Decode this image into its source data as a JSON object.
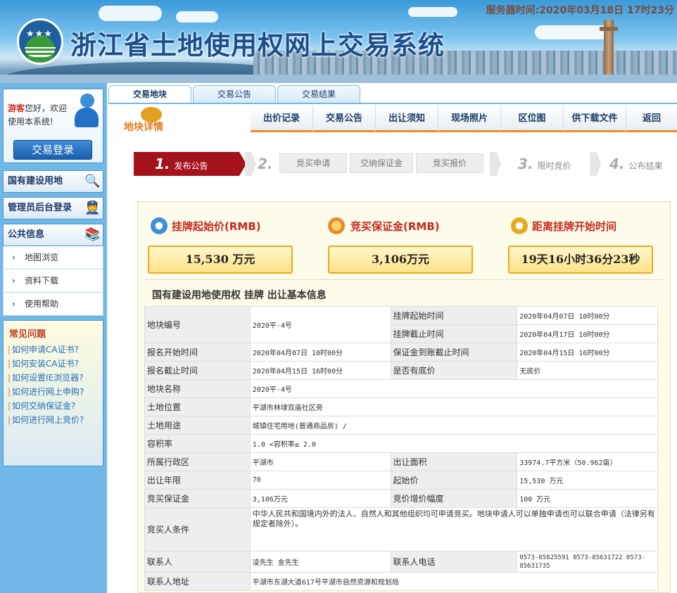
{
  "header": {
    "site_title": "浙江省土地使用权网上交易系统",
    "server_time": "服务器时间:2020年03月18日  17时23分"
  },
  "sidebar": {
    "welcome_guest": "游客",
    "welcome_text": "您好，欢迎使用本系统!",
    "login_button": "交易登录",
    "sections": {
      "gov_land": "国有建设用地",
      "admin_login": "管理员后台登录",
      "public_info": "公共信息"
    },
    "public_items": [
      "地图浏览",
      "资料下载",
      "使用帮助"
    ],
    "faq_title": "常见问题",
    "faq_items": [
      "如何申请CA证书?",
      "如何安装CA证书?",
      "如何设置IE浏览器?",
      "如何进行网上申购?",
      "如何交纳保证金?",
      "如何进行网上竞价?"
    ]
  },
  "top_tabs": [
    "交易地块",
    "交易公告",
    "交易结果"
  ],
  "detail_label": "地块详情",
  "sub_tabs": [
    "出价记录",
    "交易公告",
    "出让须知",
    "现场照片",
    "区位图",
    "供下载文件",
    "返回"
  ],
  "steps": {
    "s1_num": "1.",
    "s1_label": "发布公告",
    "s2_num": "2.",
    "s2_items": [
      "竞买申请",
      "交纳保证金",
      "竞买报价"
    ],
    "s3_num": "3.",
    "s3_label": "限时竞价",
    "s4_num": "4.",
    "s4_label": "公布结果"
  },
  "stats": {
    "start_price_title": "挂牌起始价(RMB)",
    "start_price_value": "15,530 万元",
    "deposit_title": "竞买保证金(RMB)",
    "deposit_value": "3,106万元",
    "countdown_title": "距离挂牌开始时间",
    "countdown_value": "19天16小时36分23秒"
  },
  "info_heading": "国有建设用地使用权 挂牌 出让基本信息",
  "info": {
    "plot_no_k": "地块编号",
    "plot_no_v": "2020平-4号",
    "list_start_k": "挂牌起始时间",
    "list_start_v": "2020年04月07日 10时00分",
    "list_end_k": "挂牌截止时间",
    "list_end_v": "2020年04月17日 10时00分",
    "apply_start_k": "报名开始时间",
    "apply_start_v": "2020年04月07日 10时00分",
    "deposit_deadline_k": "保证金到账截止时间",
    "deposit_deadline_v": "2020年04月15日 16时00分",
    "apply_end_k": "报名截止时间",
    "apply_end_v": "2020年04月15日 16时00分",
    "reserve_k": "是否有底价",
    "reserve_v": "无底价",
    "name_k": "地块名称",
    "name_v": "2020平-4号",
    "location_k": "土地位置",
    "location_v": "平湖市林埭双庙社区旁",
    "usage_k": "土地用途",
    "usage_v": "城镇住宅用地(普通商品房) /",
    "far_k": "容积率",
    "far_v": "1.0 <容积率≤ 2.0",
    "district_k": "所属行政区",
    "district_v": "平湖市",
    "area_k": "出让面积",
    "area_v": "33974.7平方米（50.962亩）",
    "term_k": "出让年限",
    "term_v": "70",
    "start_price_k": "起始价",
    "start_price_v": "15,530 万元",
    "deposit_k": "竞买保证金",
    "deposit_v": "3,106万元",
    "increment_k": "竞价增价幅度",
    "increment_v": "100 万元",
    "condition_k": "竞买人条件",
    "condition_v": "中华人民共和国境内外的法人、自然人和其他组织均可申请竞买。地块申请人可以单独申请也可以联合申请（法律另有规定者除外）。",
    "contact_k": "联系人",
    "contact_v": "凌先生 金先生",
    "phone_k": "联系人电话",
    "phone_v": "0573-85825591 0573-85631722 0573-85631735",
    "address_k": "联系人地址",
    "address_v": "平湖市东湖大道617号平湖市自然资源和规划局"
  }
}
